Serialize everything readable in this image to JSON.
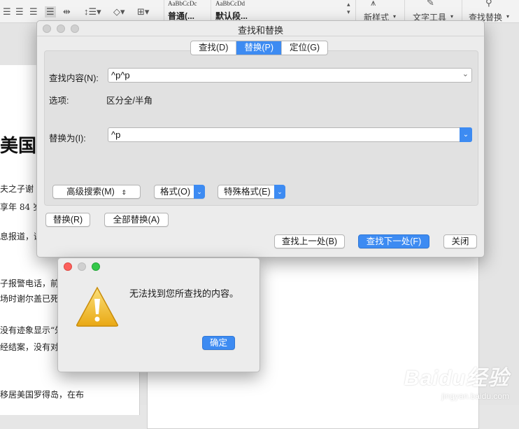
{
  "ribbon": {
    "style_samples": [
      "AaBbCcDc",
      "AaBbCcDd"
    ],
    "style_names": [
      "普通(...",
      "默认段..."
    ],
    "new_style_label": "新样式",
    "text_tools_label": "文字工具",
    "find_replace_label": "查找替换"
  },
  "document": {
    "heading": "美国",
    "lines": [
      "夫之子谢",
      "享年 84 岁",
      "息报道，谢",
      "子报警电话，前",
      "场时谢尔盖已死",
      "没有迹象显示“外",
      "经结案，没有对",
      "移居美国罗得岛，在布"
    ]
  },
  "dialog": {
    "title": "查找和替换",
    "tabs": [
      {
        "label": "查找(D)",
        "active": false
      },
      {
        "label": "替换(P)",
        "active": true
      },
      {
        "label": "定位(G)",
        "active": false
      }
    ],
    "find_label": "查找内容(N):",
    "find_value": "^p^p",
    "options_label": "选项:",
    "options_value": "区分全/半角",
    "replace_label": "替换为(I):",
    "replace_value": "^p",
    "advanced_search": "高级搜索(M)",
    "format": "格式(O)",
    "special_format": "特殊格式(E)",
    "replace_btn": "替换(R)",
    "replace_all_btn": "全部替换(A)",
    "find_prev_btn": "查找上一处(B)",
    "find_next_btn": "查找下一处(F)",
    "close_btn": "关闭"
  },
  "alert": {
    "message": "无法找到您所查找的内容。",
    "ok_label": "确定"
  },
  "watermark": {
    "brand": "Baidu经验",
    "url": "jingyan.baidu.com"
  },
  "colors": {
    "accent": "#3d8bf2",
    "close_red": "#fc605c",
    "minimize_yellow": "#fdbc40",
    "zoom_green": "#34c84a",
    "warning_yellow": "#f2c12e"
  }
}
